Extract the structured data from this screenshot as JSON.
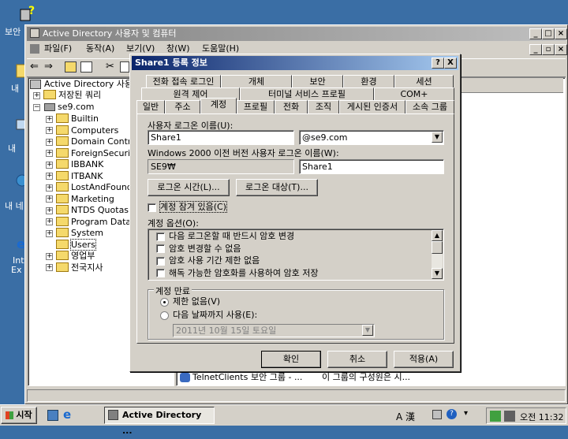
{
  "desktop": {
    "icons": [
      {
        "label": "보안"
      },
      {
        "label": "내"
      },
      {
        "label": "내 "
      },
      {
        "label": "내 네"
      },
      {
        "label": "Int"
      },
      {
        "label": "Ex"
      }
    ]
  },
  "main_window": {
    "title": "Active Directory 사용자 및 컴퓨터",
    "menu": [
      "파일(F)",
      "동작(A)",
      "보기(V)",
      "창(W)",
      "도움말(H)"
    ],
    "tree": {
      "root": "Active Directory 사용자",
      "saved_queries": "저장된 쿼리",
      "domain": "se9.com",
      "children": [
        "Builtin",
        "Computers",
        "Domain Contro",
        "ForeignSecurit",
        "IBBANK",
        "ITBANK",
        "LostAndFound",
        "Marketing",
        "NTDS Quotas",
        "Program Data",
        "System",
        "Users",
        "영업부",
        "전국지사"
      ]
    },
    "list_row": {
      "name": "TelnetClients",
      "type": "보안 그룹 - ...",
      "desc": "이 그룹의 구성원은 시..."
    }
  },
  "dialog": {
    "title": "Share1 등록 정보",
    "help_btn": "?",
    "close_btn": "X",
    "tabs_row1": [
      "전화 접속 로그인",
      "개체",
      "보안",
      "환경",
      "세션"
    ],
    "tabs_row2": [
      "원격 제어",
      "터미널 서비스 프로필",
      "COM+"
    ],
    "tabs_row3": [
      "일반",
      "주소",
      "계정",
      "프로필",
      "전화",
      "조직",
      "게시된 인증서",
      "소속 그룹"
    ],
    "logon_name_label": "사용자 로그온 이름(U):",
    "logon_name_value": "Share1",
    "domain_suffix": "@se9.com",
    "pre2000_label": "Windows 2000 이전 버전 사용자 로그온 이름(W):",
    "pre2000_domain": "SE9₩",
    "pre2000_value": "Share1",
    "logon_hours_btn": "로그온 시간(L)...",
    "logon_to_btn": "로그온 대상(T)...",
    "locked_label": "계정 잠겨 있음(C)",
    "options_label": "계정 옵션(O):",
    "options": [
      "다음 로그온할 때 반드시 암호 변경",
      "암호 변경할 수 없음",
      "암호 사용 기간 제한 없음",
      "해독 가능한 암호화를 사용하여 암호 저장"
    ],
    "expires_label": "계정 만료",
    "never_label": "제한 없음(V)",
    "end_of_label": "다음 날짜까지 사용(E):",
    "date_value": "2011년 10월 15일 토요일",
    "ok_btn": "확인",
    "cancel_btn": "취소",
    "apply_btn": "적용(A)"
  },
  "taskbar": {
    "start": "시작",
    "task": "Active Directory ...",
    "ime": "A 漢",
    "clock": "오전 11:32"
  }
}
